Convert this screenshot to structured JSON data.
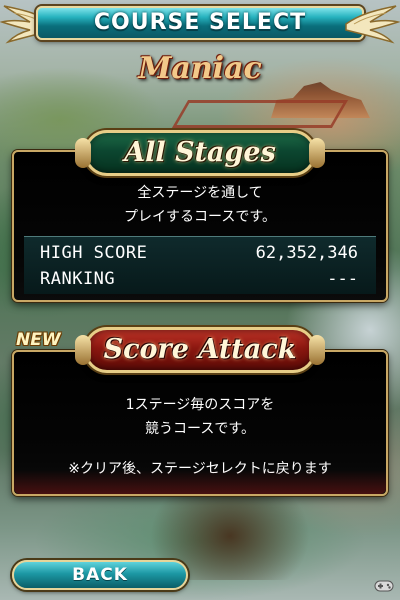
{
  "header": {
    "title": "COURSE SELECT"
  },
  "difficulty": {
    "label": "Maniac"
  },
  "all_stages": {
    "button_label": "All Stages",
    "description_line1": "全ステージを通して",
    "description_line2": "プレイするコースです。",
    "stats": {
      "high_score_label": "HIGH SCORE",
      "high_score_value": "62,352,346",
      "ranking_label": "RANKING",
      "ranking_value": "---"
    }
  },
  "score_attack": {
    "badge": "NEW",
    "button_label": "Score Attack",
    "description_line1": "1ステージ毎のスコアを",
    "description_line2": "競うコースです。",
    "note": "※クリア後、ステージセレクトに戻ります"
  },
  "footer": {
    "back_label": "BACK"
  },
  "icons": {
    "header_left": "wing-ornament-icon",
    "header_right": "wing-ornament-icon",
    "watermark": "gamepad-logo-icon"
  },
  "colors": {
    "header_teal": "#27b3bf",
    "gold_trim": "#c9a865",
    "all_stages_green": "#0c4630",
    "score_attack_red": "#8b1710",
    "difficulty_text": "#f2c98a"
  }
}
